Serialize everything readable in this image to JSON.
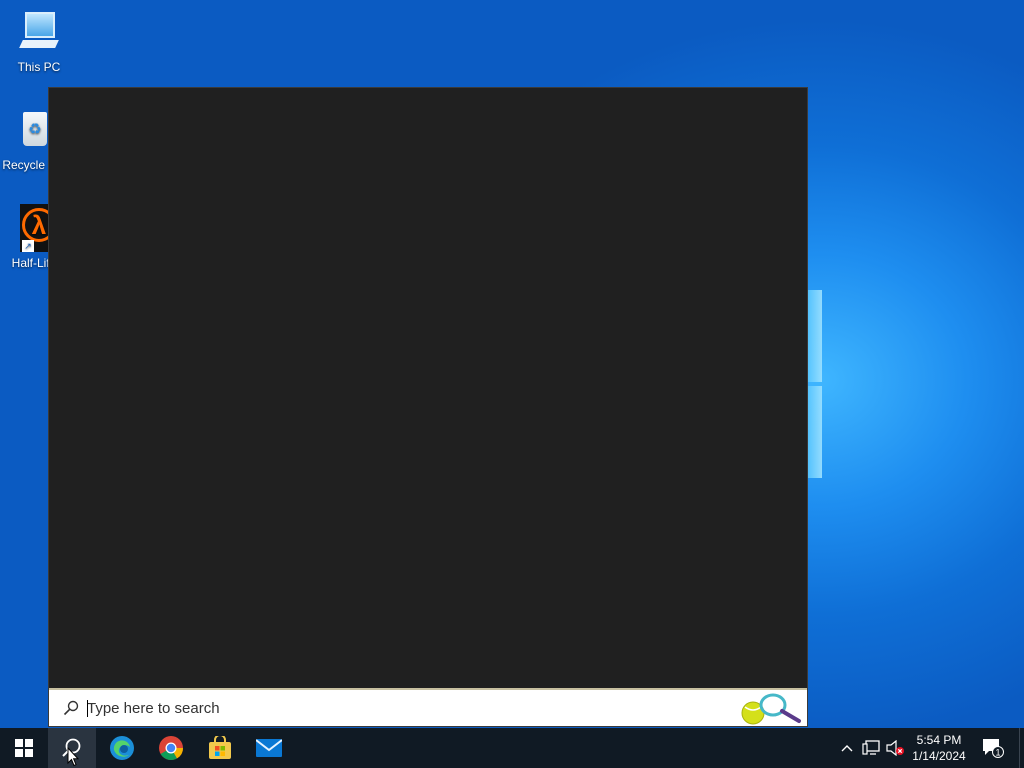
{
  "desktop": {
    "icons": [
      {
        "label": "This PC"
      },
      {
        "label": "Recycle Bin"
      },
      {
        "label": "Half-Life"
      }
    ]
  },
  "search": {
    "placeholder": "Type here to search"
  },
  "taskbar": {
    "apps": [
      "start-icon",
      "search-icon",
      "edge-icon",
      "chrome-icon",
      "store-icon",
      "mail-icon"
    ],
    "clock_time": "5:54 PM",
    "clock_date": "1/14/2024",
    "notification_count": "1"
  },
  "colors": {
    "panel": "#202020",
    "taskbar": "#101a24",
    "desktop": "#0b5bc2"
  }
}
